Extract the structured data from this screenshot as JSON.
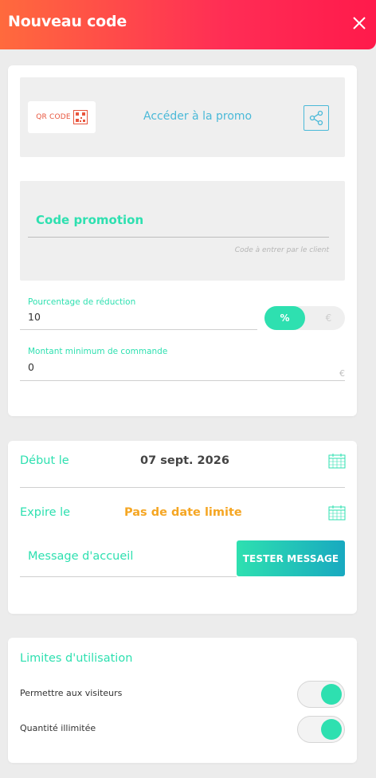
{
  "header": {
    "title": "Nouveau code"
  },
  "promo": {
    "qr_label": "QR CODE",
    "access_link": "Accéder à la promo"
  },
  "code": {
    "title": "Code promotion",
    "hint": "Code à entrer par le client"
  },
  "discount": {
    "label": "Pourcentage de réduction",
    "value": "10",
    "unit_percent": "%",
    "unit_euro": "€"
  },
  "minimum": {
    "label": "Montant minimum de commande",
    "value": "0",
    "suffix": "€"
  },
  "dates": {
    "start_label": "Début le",
    "start_value": "07 sept. 2026",
    "end_label": "Expire le",
    "end_value": "Pas de date limite"
  },
  "message": {
    "label": "Message d'accueil",
    "test_button": "TESTER MESSAGE"
  },
  "limits": {
    "title": "Limites d'utilisation",
    "allow_visitors_label": "Permettre aux visiteurs",
    "allow_visitors_on": true,
    "unlimited_label": "Quantité illimitée",
    "unlimited_on": true
  },
  "colors": {
    "accent": "#2ee0b0",
    "link": "#4ab9d8",
    "warning": "#f5a623",
    "header_start": "#ff6a3d",
    "header_end": "#ff1a4b"
  }
}
